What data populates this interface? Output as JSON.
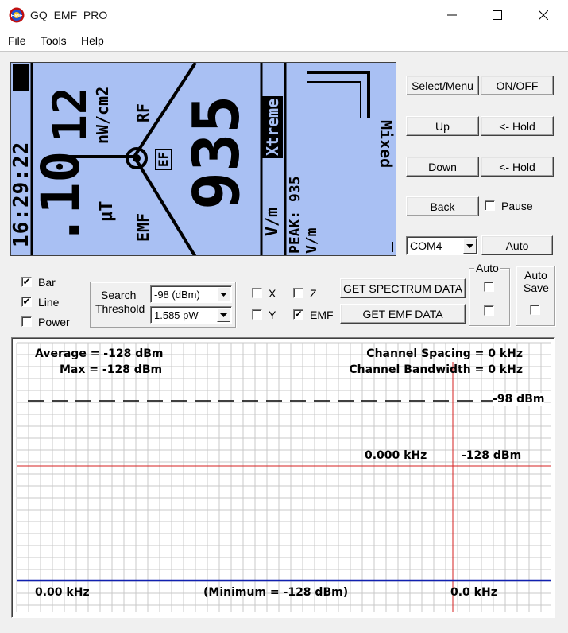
{
  "window": {
    "title": "GQ_EMF_PRO"
  },
  "menu": [
    "File",
    "Tools",
    "Help"
  ],
  "lcd": {
    "time": "16:29:22",
    "mag_value": ".10",
    "mag_unit": "µT",
    "mag_label": "EMF",
    "rf_value": "12",
    "rf_unit": "nW/cm2",
    "rf_label": "RF",
    "ef_badge": "EF",
    "main_value": "935",
    "main_unit": "V/m",
    "mode_badge": "Xtreme",
    "peak_text": "PEAK: 935 V/m",
    "mixed_label": "Mixed"
  },
  "buttons": {
    "select_menu": "Select/Menu",
    "on_off": "ON/OFF",
    "up": "Up",
    "hold1": "<- Hold",
    "down": "Down",
    "hold2": "<- Hold",
    "back": "Back",
    "auto": "Auto",
    "get_spectrum": "GET SPECTRUM DATA",
    "get_emf": "GET EMF DATA"
  },
  "pause_label": "Pause",
  "com_port": "COM4",
  "checks": {
    "bar": {
      "label": "Bar",
      "checked": true
    },
    "line": {
      "label": "Line",
      "checked": true
    },
    "power": {
      "label": "Power",
      "checked": false
    },
    "x": {
      "label": "X",
      "checked": false
    },
    "z": {
      "label": "Z",
      "checked": false
    },
    "y": {
      "label": "Y",
      "checked": false
    },
    "emf": {
      "label": "EMF",
      "checked": true
    }
  },
  "search_threshold": {
    "label_line1": "Search",
    "label_line2": "Threshold",
    "dbm_value": "-98 (dBm)",
    "pw_value": "1.585 pW"
  },
  "auto_group": {
    "label": "Auto"
  },
  "auto_save": {
    "label_line1": "Auto",
    "label_line2": "Save"
  },
  "chart": {
    "average": "Average = -128 dBm",
    "max": "Max = -128 dBm",
    "channel_spacing": "Channel Spacing = 0 kHz",
    "channel_bandwidth": "Channel Bandwidth = 0 kHz",
    "threshold_label": "-98 dBm",
    "cursor_freq": "0.000 kHz",
    "cursor_level": "-128 dBm",
    "x_left": "0.00 kHz",
    "minimum": "(Minimum = -128 dBm)",
    "x_right": "0.0 kHz",
    "colors": {
      "grid": "#c8c8c8",
      "cursor": "#d62020",
      "signal": "#1020b0",
      "threshold": "#000000"
    }
  }
}
